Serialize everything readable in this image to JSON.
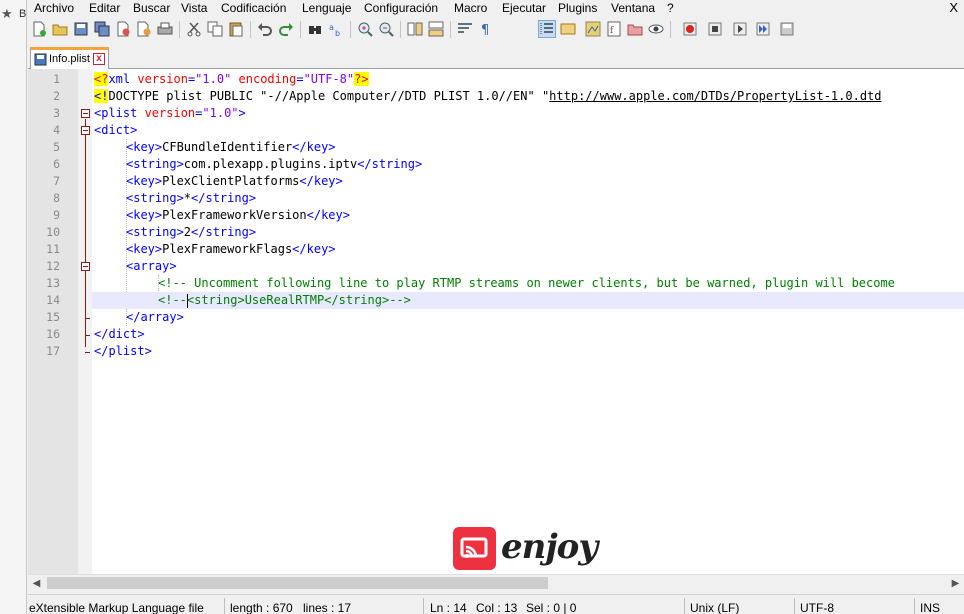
{
  "background_window": {
    "label": "B"
  },
  "menu": [
    "Archivo",
    "Editar",
    "Buscar",
    "Vista",
    "Codificación",
    "Lenguaje",
    "Configuración",
    "Macro",
    "Ejecutar",
    "Plugins",
    "Ventana",
    "?"
  ],
  "window_close": "X",
  "tab": {
    "label": "Info.plist",
    "close": "x"
  },
  "line_numbers": [
    "1",
    "2",
    "3",
    "4",
    "5",
    "6",
    "7",
    "8",
    "9",
    "10",
    "11",
    "12",
    "13",
    "14",
    "15",
    "16",
    "17"
  ],
  "code": {
    "l1": [
      "<?",
      "xml",
      " version",
      "=",
      "\"1.0\"",
      " encoding",
      "=",
      "\"UTF-8\"",
      "?>"
    ],
    "l2": [
      "<!",
      "DOCTYPE plist PUBLIC ",
      "\"-//Apple Computer//DTD PLIST 1.0//EN\"",
      " \"",
      "http://www.apple.com/DTDs/PropertyList-1.0.dtd"
    ],
    "l3": [
      "<plist",
      " version",
      "=",
      "\"1.0\"",
      ">"
    ],
    "l4": "<dict>",
    "l5": [
      "<key>",
      "CFBundleIdentifier",
      "</key>"
    ],
    "l6": [
      "<string>",
      "com.plexapp.plugins.iptv",
      "</string>"
    ],
    "l7": [
      "<key>",
      "PlexClientPlatforms",
      "</key>"
    ],
    "l8": [
      "<string>",
      "*",
      "</string>"
    ],
    "l9": [
      "<key>",
      "PlexFrameworkVersion",
      "</key>"
    ],
    "l10": [
      "<string>",
      "2",
      "</string>"
    ],
    "l11": [
      "<key>",
      "PlexFrameworkFlags",
      "</key>"
    ],
    "l12": "<array>",
    "l13": "<!-- Uncomment following line to play RTMP streams on newer clients, but be warned, plugin will become",
    "l14": [
      "<!--",
      "<string>UseRealRTMP</string>-->"
    ],
    "l15": "</array>",
    "l16": "</dict>",
    "l17": "</plist>"
  },
  "watermark": {
    "text": "enjoy"
  },
  "status": {
    "language": "eXtensible Markup Language file",
    "length": "length : 670",
    "lines": "lines : 17",
    "ln": "Ln : 14",
    "col": "Col : 13",
    "sel": "Sel : 0 | 0",
    "eol": "Unix (LF)",
    "encoding": "UTF-8",
    "mode": "INS"
  },
  "colors": {
    "tag": "#0000ff",
    "attribute": "#ff0000",
    "value": "#8000ff",
    "comment": "#008000",
    "current_line": "#e8e8ff",
    "tab_accent": "#f6a53d",
    "watermark": "#ee3140"
  }
}
